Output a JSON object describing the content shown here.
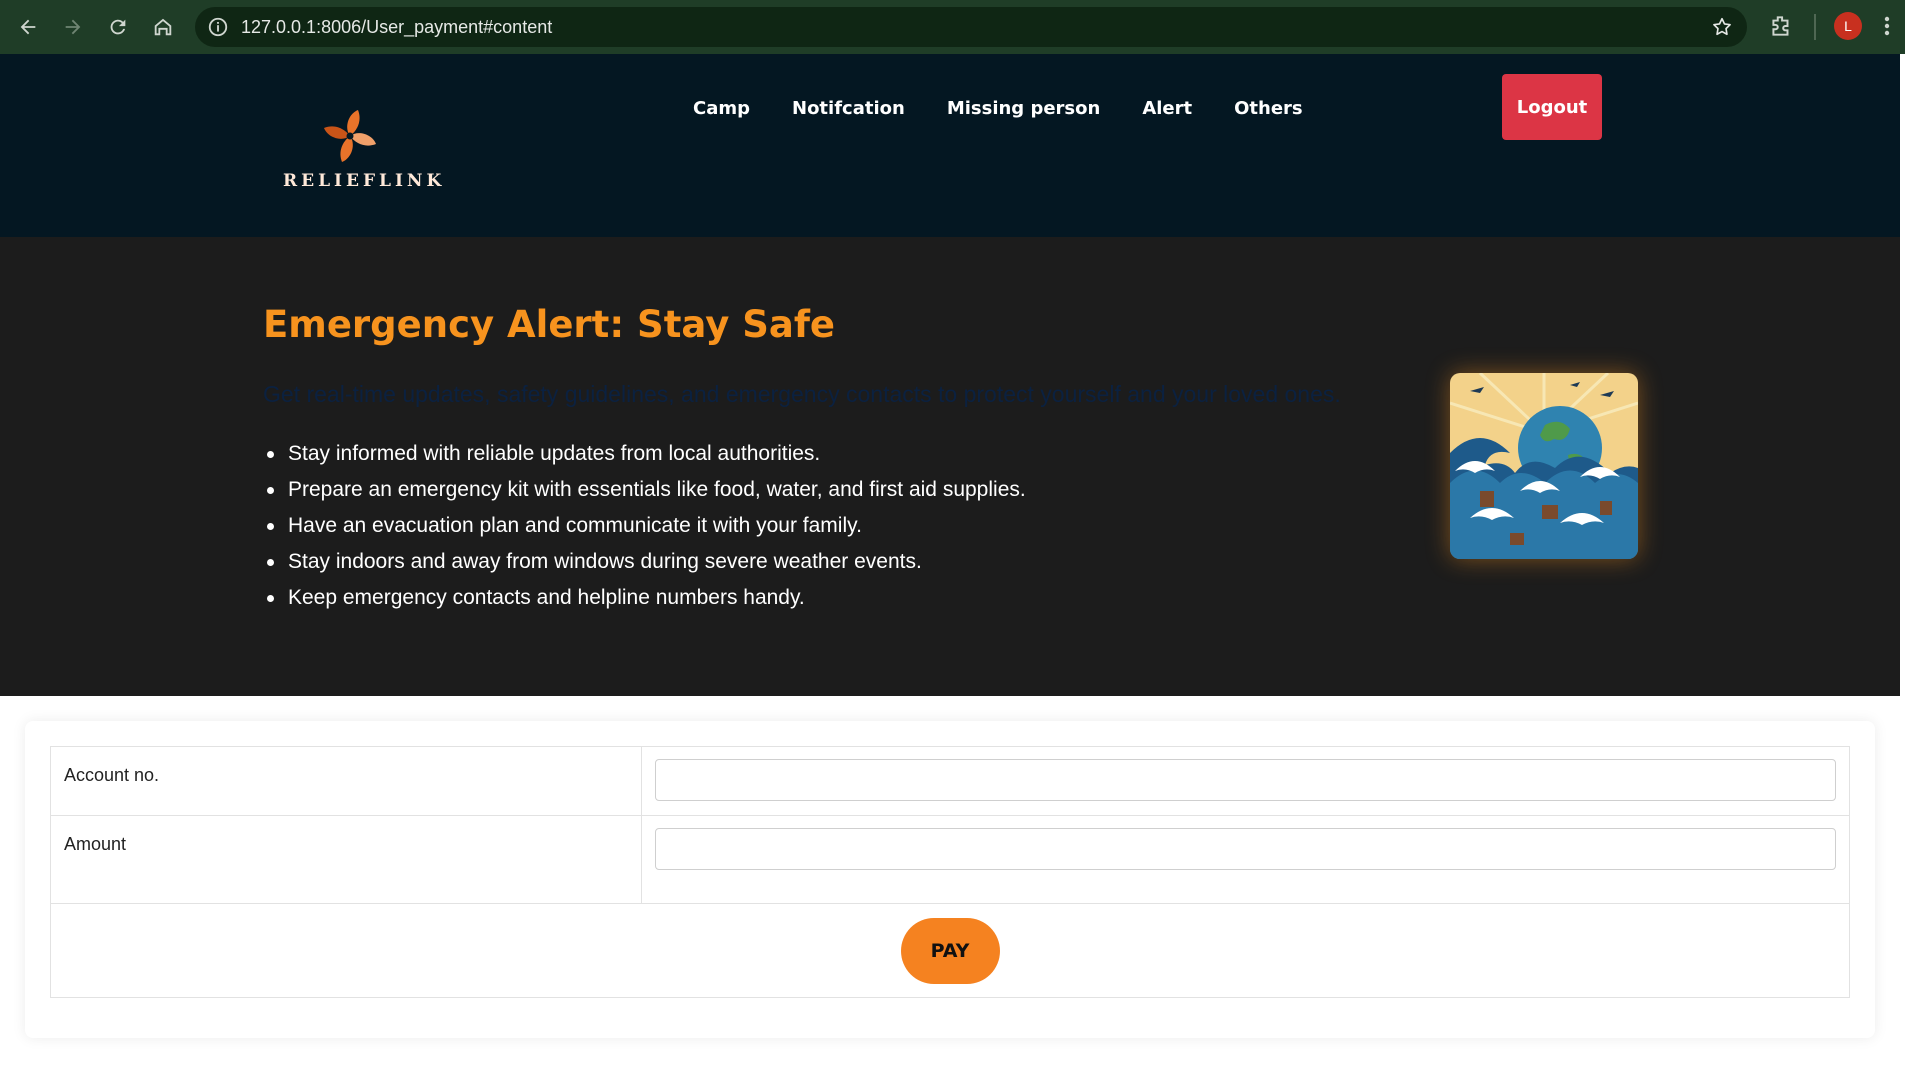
{
  "browser": {
    "url": "127.0.0.1:8006/User_payment#content",
    "profile_initial": "L"
  },
  "header": {
    "logo_text": "RELIEFLINK",
    "nav": [
      "Camp",
      "Notifcation",
      "Missing person",
      "Alert",
      "Others"
    ],
    "logout_label": "Logout"
  },
  "hero": {
    "title": "Emergency Alert: Stay Safe",
    "subtitle": "Get real-time updates, safety guidelines, and emergency contacts to protect yourself and your loved ones.",
    "items": [
      "Stay informed with reliable updates from local authorities.",
      "Prepare an emergency kit with essentials like food, water, and first aid supplies.",
      "Have an evacuation plan and communicate it with your family.",
      "Stay indoors and away from windows during severe weather events.",
      "Keep emergency contacts and helpline numbers handy."
    ]
  },
  "form": {
    "account_label": "Account no.",
    "account_value": "",
    "amount_label": "Amount",
    "amount_value": "",
    "pay_label": "PAY"
  },
  "colors": {
    "browser_bar": "#1f3d27",
    "header_bg": "#041722",
    "hero_bg": "#1c1c1c",
    "accent_orange": "#f7931e",
    "logout_red": "#dc3545",
    "pay_orange": "#f58220"
  }
}
